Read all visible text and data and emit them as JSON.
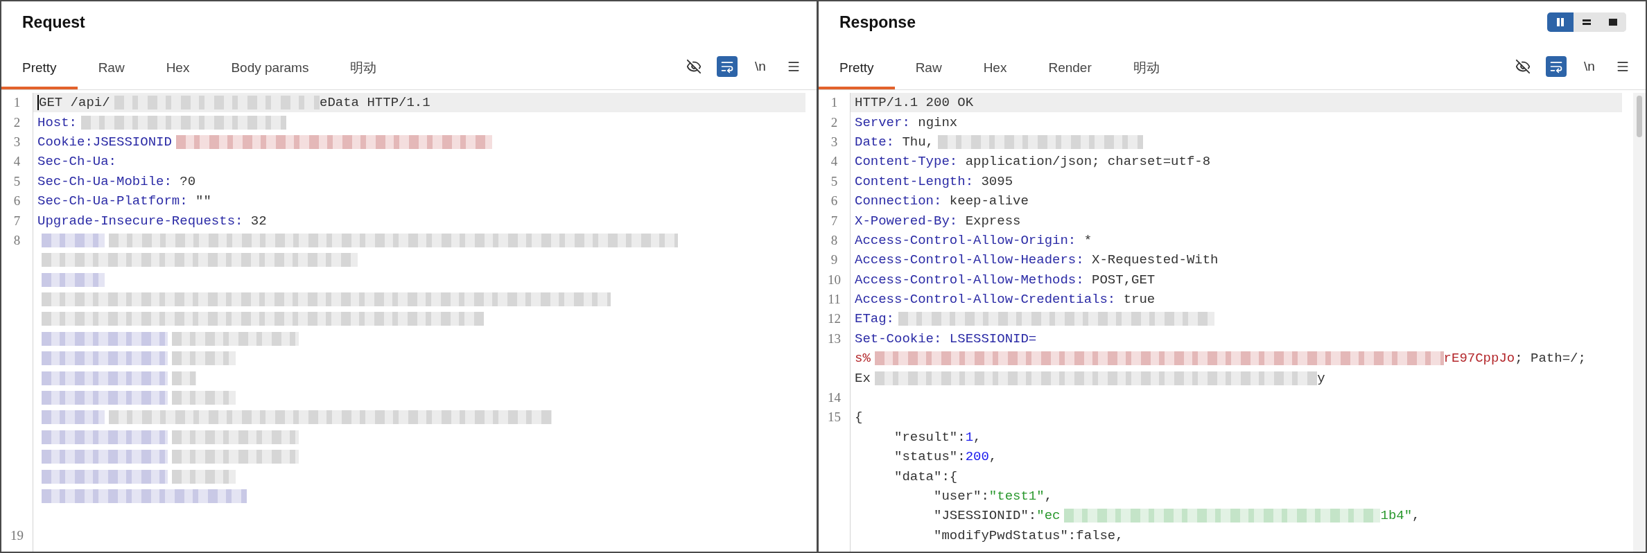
{
  "request": {
    "title": "Request",
    "tabs": [
      {
        "label": "Pretty",
        "selected": true
      },
      {
        "label": "Raw",
        "selected": false
      },
      {
        "label": "Hex",
        "selected": false
      },
      {
        "label": "Body params",
        "selected": false
      },
      {
        "label": "明动",
        "selected": false
      }
    ],
    "toolbar": [
      {
        "kind": "hide",
        "selected": false
      },
      {
        "kind": "wrap",
        "selected": true
      },
      {
        "kind": "newline",
        "label": "\\n",
        "selected": false
      },
      {
        "kind": "menu",
        "selected": false
      }
    ],
    "scrollbar": false,
    "lines": [
      {
        "number": "1",
        "current": true,
        "cursor": true,
        "segments": [
          {
            "kind": "text",
            "text": "GET /api/"
          },
          {
            "kind": "blur_plain_l"
          },
          {
            "kind": "text",
            "text": "eData HTTP/1.1"
          }
        ]
      },
      {
        "number": "2",
        "current": false,
        "segments": [
          {
            "kind": "key",
            "text": "Host:"
          },
          {
            "kind": "blur_plain_l"
          }
        ]
      },
      {
        "number": "3",
        "current": false,
        "segments": [
          {
            "kind": "key",
            "text": "Cookie:JSESSIONID"
          },
          {
            "kind": "blur_cookie_xl"
          }
        ]
      },
      {
        "number": "4",
        "current": false,
        "segments": [
          {
            "kind": "key",
            "text": "Sec-Ch-Ua:"
          }
        ]
      },
      {
        "number": "5",
        "current": false,
        "segments": [
          {
            "kind": "key",
            "text": "Sec-Ch-Ua-Mobile:"
          },
          {
            "kind": "text",
            "text": " ?0"
          }
        ]
      },
      {
        "number": "6",
        "current": false,
        "segments": [
          {
            "kind": "key",
            "text": "Sec-Ch-Ua-Platform:"
          },
          {
            "kind": "text",
            "text": " \"\""
          }
        ]
      },
      {
        "number": "7",
        "current": false,
        "segments": [
          {
            "kind": "key",
            "text": "Upgrade-Insecure-Requests:"
          },
          {
            "kind": "text",
            "text": " 32"
          }
        ]
      },
      {
        "number": "8",
        "current": false,
        "segments": [
          {
            "kind": "blur_key_s"
          },
          {
            "kind": "blur_plain_x4"
          }
        ]
      },
      {
        "current": false,
        "segments": [
          {
            "kind": "blur_plain_xl"
          }
        ]
      },
      {
        "current": false,
        "segments": [
          {
            "kind": "blur_key_s"
          }
        ]
      },
      {
        "current": false,
        "segments": [
          {
            "kind": "blur_plain_x4"
          }
        ]
      },
      {
        "current": false,
        "segments": [
          {
            "kind": "blur_plain_xxl"
          }
        ]
      },
      {
        "current": false,
        "segments": [
          {
            "kind": "blur_key_m"
          },
          {
            "kind": "blur_plain_m"
          }
        ]
      },
      {
        "current": false,
        "segments": [
          {
            "kind": "blur_key_m"
          },
          {
            "kind": "blur_plain_s"
          }
        ]
      },
      {
        "current": false,
        "segments": [
          {
            "kind": "blur_key_m"
          },
          {
            "kind": "blur_plain_xs"
          }
        ]
      },
      {
        "current": false,
        "segments": [
          {
            "kind": "blur_key_m"
          },
          {
            "kind": "blur_plain_s"
          }
        ]
      },
      {
        "current": false,
        "segments": [
          {
            "kind": "blur_key_s"
          },
          {
            "kind": "blur_plain_xxl"
          }
        ]
      },
      {
        "current": false,
        "segments": [
          {
            "kind": "blur_key_m"
          },
          {
            "kind": "blur_plain_m"
          }
        ]
      },
      {
        "current": false,
        "segments": [
          {
            "kind": "blur_key_m"
          },
          {
            "kind": "blur_plain_m"
          }
        ]
      },
      {
        "current": false,
        "segments": [
          {
            "kind": "blur_key_m"
          },
          {
            "kind": "blur_plain_s"
          }
        ]
      },
      {
        "current": false,
        "segments": [
          {
            "kind": "blur_key_l"
          }
        ]
      },
      {
        "current": false
      },
      {
        "number": "19",
        "current": false
      }
    ]
  },
  "response": {
    "title": "Response",
    "layout_buttons": [
      {
        "kind": "columns",
        "selected": true
      },
      {
        "kind": "rows",
        "selected": false
      },
      {
        "kind": "single",
        "selected": false
      }
    ],
    "tabs": [
      {
        "label": "Pretty",
        "selected": true
      },
      {
        "label": "Raw",
        "selected": false
      },
      {
        "label": "Hex",
        "selected": false
      },
      {
        "label": "Render",
        "selected": false
      },
      {
        "label": "明动",
        "selected": false
      }
    ],
    "toolbar": [
      {
        "kind": "hide",
        "selected": false
      },
      {
        "kind": "wrap",
        "selected": true
      },
      {
        "kind": "newline",
        "label": "\\n",
        "selected": false
      },
      {
        "kind": "menu",
        "selected": false
      }
    ],
    "scrollbar": true,
    "lines": [
      {
        "number": "1",
        "current": true,
        "segments": [
          {
            "kind": "text",
            "text": "HTTP/1.1 200 OK"
          }
        ]
      },
      {
        "number": "2",
        "current": false,
        "segments": [
          {
            "kind": "key",
            "text": "Server:"
          },
          {
            "kind": "text",
            "text": " nginx"
          }
        ]
      },
      {
        "number": "3",
        "current": false,
        "segments": [
          {
            "kind": "key",
            "text": "Date:"
          },
          {
            "kind": "text",
            "text": " Thu,"
          },
          {
            "kind": "blur_plain_l"
          }
        ]
      },
      {
        "number": "4",
        "current": false,
        "segments": [
          {
            "kind": "key",
            "text": "Content-Type:"
          },
          {
            "kind": "text",
            "text": " application/json; charset=utf-8"
          }
        ]
      },
      {
        "number": "5",
        "current": false,
        "segments": [
          {
            "kind": "key",
            "text": "Content-Length:"
          },
          {
            "kind": "text",
            "text": " 3095"
          }
        ]
      },
      {
        "number": "6",
        "current": false,
        "segments": [
          {
            "kind": "key",
            "text": "Connection:"
          },
          {
            "kind": "text",
            "text": " keep-alive"
          }
        ]
      },
      {
        "number": "7",
        "current": false,
        "segments": [
          {
            "kind": "key",
            "text": "X-Powered-By:"
          },
          {
            "kind": "text",
            "text": " Express"
          }
        ]
      },
      {
        "number": "8",
        "current": false,
        "segments": [
          {
            "kind": "key",
            "text": "Access-Control-Allow-Origin:"
          },
          {
            "kind": "text",
            "text": " *"
          }
        ]
      },
      {
        "number": "9",
        "current": false,
        "segments": [
          {
            "kind": "key",
            "text": "Access-Control-Allow-Headers:"
          },
          {
            "kind": "text",
            "text": " X-Requested-With"
          }
        ]
      },
      {
        "number": "10",
        "current": false,
        "segments": [
          {
            "kind": "key",
            "text": "Access-Control-Allow-Methods:"
          },
          {
            "kind": "text",
            "text": " POST,GET"
          }
        ]
      },
      {
        "number": "11",
        "current": false,
        "segments": [
          {
            "kind": "key",
            "text": "Access-Control-Allow-Credentials:"
          },
          {
            "kind": "text",
            "text": " true"
          }
        ]
      },
      {
        "number": "12",
        "current": false,
        "segments": [
          {
            "kind": "key",
            "text": "ETag:"
          },
          {
            "kind": "blur_plain_xl"
          }
        ]
      },
      {
        "number": "13",
        "current": false,
        "segments": [
          {
            "kind": "key",
            "text": "Set-Cookie:"
          },
          {
            "kind": "key",
            "text": " LSESSIONID="
          }
        ]
      },
      {
        "current": false,
        "segments": [
          {
            "kind": "cookie",
            "text": "s%"
          },
          {
            "kind": "blur_cookie_x4"
          },
          {
            "kind": "cookie",
            "text": "rE97CppJo"
          },
          {
            "kind": "text",
            "text": "; Path=/;"
          }
        ]
      },
      {
        "current": false,
        "segments": [
          {
            "kind": "text",
            "text": "Ex"
          },
          {
            "kind": "blur_plain_xxl"
          },
          {
            "kind": "text",
            "text": "y"
          }
        ]
      },
      {
        "number": "14",
        "current": false
      },
      {
        "number": "15",
        "current": false,
        "segments": [
          {
            "kind": "text",
            "text": "{"
          }
        ]
      },
      {
        "current": false,
        "segments": [
          {
            "kind": "text",
            "text": "\t\"result\":"
          },
          {
            "kind": "number",
            "text": "1"
          },
          {
            "kind": "text",
            "text": ","
          }
        ]
      },
      {
        "current": false,
        "segments": [
          {
            "kind": "text",
            "text": "\t\"status\":"
          },
          {
            "kind": "number",
            "text": "200"
          },
          {
            "kind": "text",
            "text": ","
          }
        ]
      },
      {
        "current": false,
        "segments": [
          {
            "kind": "text",
            "text": "\t\"data\":{"
          }
        ]
      },
      {
        "current": false,
        "segments": [
          {
            "kind": "text",
            "text": "\t\t\"user\":"
          },
          {
            "kind": "string",
            "text": "\"test1\""
          },
          {
            "kind": "text",
            "text": ","
          }
        ]
      },
      {
        "current": false,
        "segments": [
          {
            "kind": "text",
            "text": "\t\t\"JSESSIONID\":"
          },
          {
            "kind": "string",
            "text": "\"ec"
          },
          {
            "kind": "blur_string_xl"
          },
          {
            "kind": "string",
            "text": "1b4\""
          },
          {
            "kind": "text",
            "text": ","
          }
        ]
      },
      {
        "current": false,
        "segments": [
          {
            "kind": "text",
            "text": "\t\t\"modifyPwdStatus\":false,"
          }
        ]
      }
    ]
  }
}
